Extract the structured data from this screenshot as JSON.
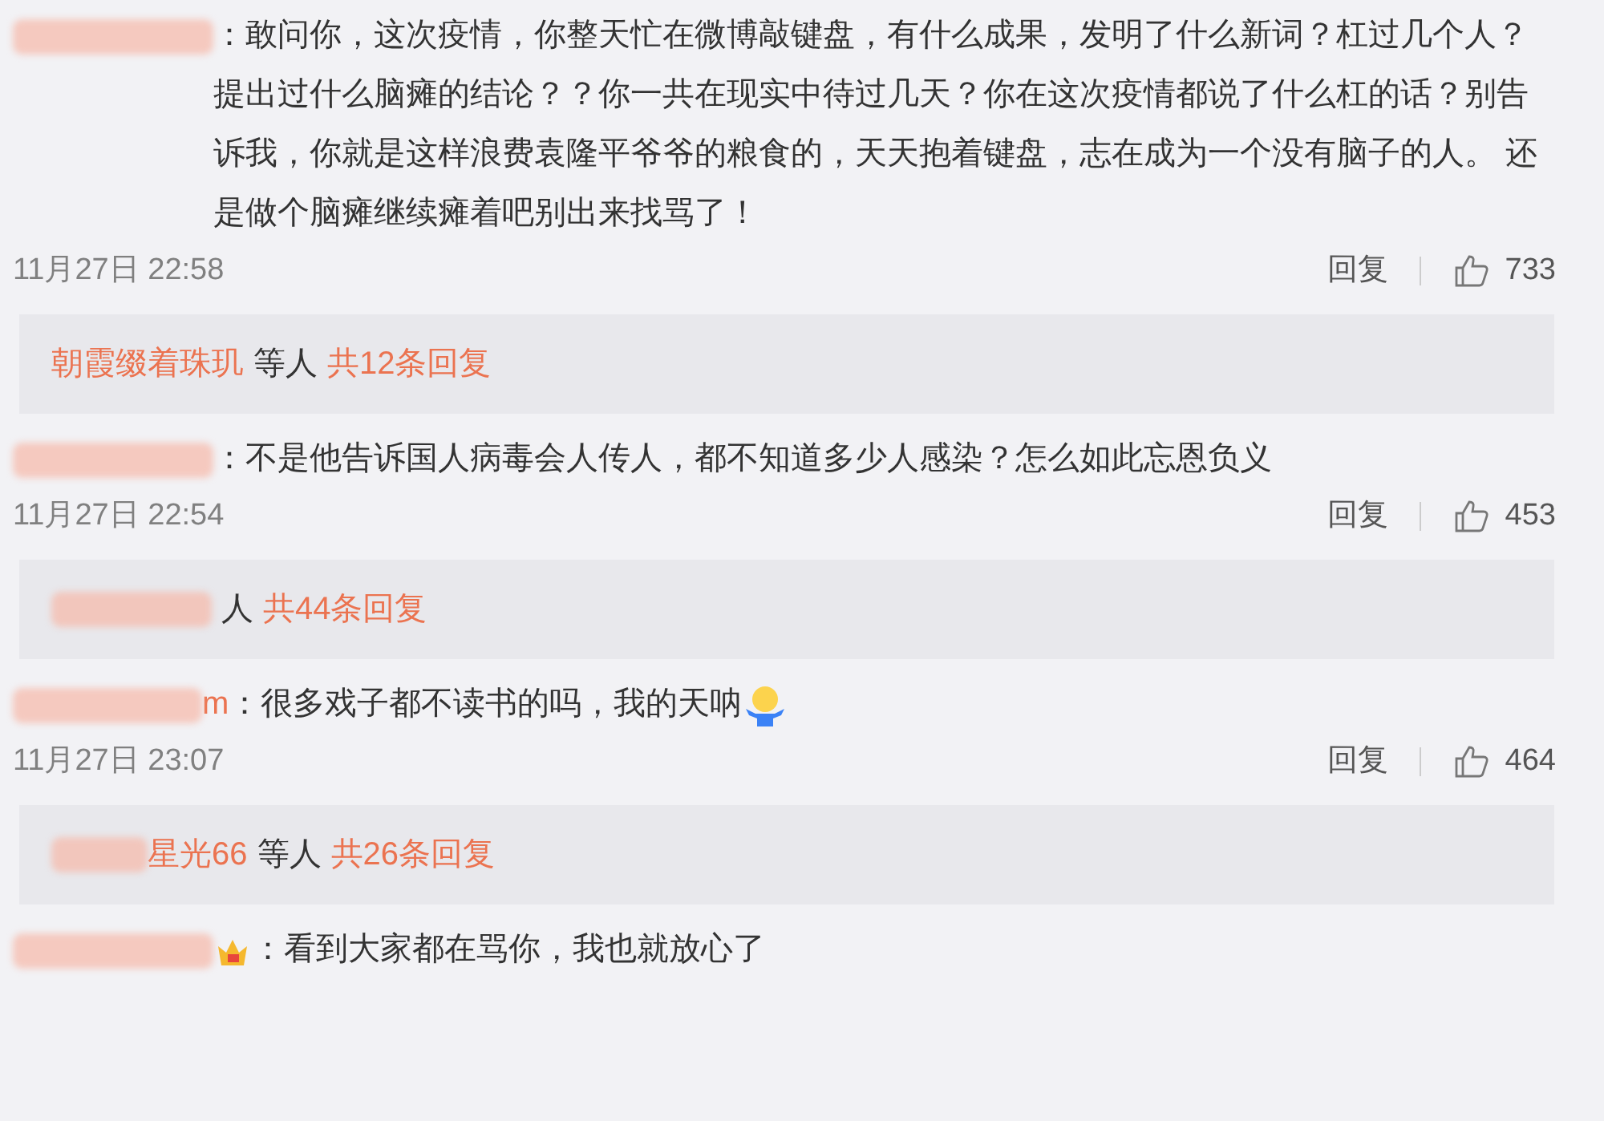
{
  "comments": [
    {
      "username": {
        "redacted": true
      },
      "badge": false,
      "text": "：敢问你，这次疫情，你整天忙在微博敲键盘，有什么成果，发明了什么新词？杠过几个人？提出过什么脑瘫的结论？？你一共在现实中待过几天？你在这次疫情都说了什么杠的话？别告诉我，你就是这样浪费袁隆平爷爷的粮食的，天天抱着键盘，志在成为一个没有脑子的人。 还是做个脑瘫继续瘫着吧别出来找骂了！",
      "emoji": false,
      "time": "11月27日 22:58",
      "reply_label": "回复",
      "likes": "733",
      "replies": {
        "redacted": false,
        "name": "朝霞缀着珠玑",
        "suffix": "等人",
        "count": "共12条回复"
      }
    },
    {
      "username": {
        "redacted": true
      },
      "badge": false,
      "text": "：不是他告诉国人病毒会人传人，都不知道多少人感染？怎么如此忘恩负义",
      "emoji": false,
      "time": "11月27日 22:54",
      "reply_label": "回复",
      "likes": "453",
      "replies": {
        "redacted": true,
        "suffix": "人",
        "count": "共44条回复"
      }
    },
    {
      "username": {
        "redacted": true,
        "text": "m"
      },
      "badge": false,
      "text": "：很多戏子都不读书的吗，我的天呐",
      "emoji": true,
      "time": "11月27日 23:07",
      "reply_label": "回复",
      "likes": "464",
      "replies": {
        "redacted": true,
        "name": "星光66",
        "suffix": "等人",
        "count": "共26条回复"
      }
    },
    {
      "username": {
        "redacted": true
      },
      "badge": true,
      "text": "：看到大家都在骂你，我也就放心了",
      "emoji": false
    }
  ]
}
